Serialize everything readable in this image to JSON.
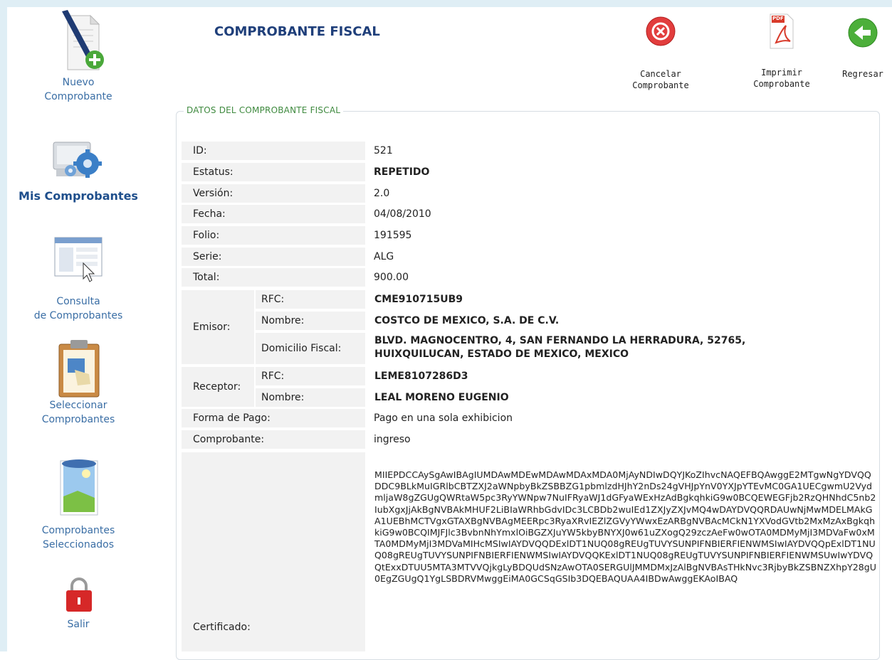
{
  "sidebar": {
    "items": [
      {
        "label_line1": "Nuevo",
        "label_line2": "Comprobante",
        "icon": "new-document-icon"
      },
      {
        "label_line1": "Mis Comprobantes",
        "label_line2": "",
        "icon": "gear-computer-icon",
        "active": true
      },
      {
        "label_line1": "Consulta",
        "label_line2": "de Comprobantes",
        "icon": "window-cursor-icon"
      },
      {
        "label_line1": "Seleccionar",
        "label_line2": "Comprobantes",
        "icon": "clipboard-icon"
      },
      {
        "label_line1": "Comprobantes",
        "label_line2": "Seleccionados",
        "icon": "picture-icon"
      },
      {
        "label_line1": "Salir",
        "label_line2": "",
        "icon": "lock-icon"
      }
    ]
  },
  "header": {
    "title": "COMPROBANTE FISCAL",
    "buttons": {
      "cancel_line1": "Cancelar",
      "cancel_line2": "Comprobante",
      "print_line1": "Imprimir",
      "print_line2": "Comprobante",
      "back": "Regresar",
      "pdf_badge": "PDF"
    }
  },
  "section": {
    "legend": "DATOS DEL COMPROBANTE FISCAL"
  },
  "fields": {
    "id_label": "ID:",
    "id_value": "521",
    "status_label": "Estatus:",
    "status_value": "REPETIDO",
    "version_label": "Versión:",
    "version_value": "2.0",
    "date_label": "Fecha:",
    "date_value": "04/08/2010",
    "folio_label": "Folio:",
    "folio_value": "191595",
    "serie_label": "Serie:",
    "serie_value": "ALG",
    "total_label": "Total:",
    "total_value": "900.00",
    "emisor_label": "Emisor:",
    "emisor_rfc_label": "RFC:",
    "emisor_rfc_value": "CME910715UB9",
    "emisor_name_label": "Nombre:",
    "emisor_name_value": "COSTCO DE MEXICO, S.A. DE C.V.",
    "emisor_addr_label": "Domicilio Fiscal:",
    "emisor_addr_line1": "BLVD. MAGNOCENTRO, 4, SAN FERNANDO LA HERRADURA, 52765,",
    "emisor_addr_line2": "HUIXQUILUCAN, ESTADO DE MEXICO, MEXICO",
    "receptor_label": "Receptor:",
    "receptor_rfc_label": "RFC:",
    "receptor_rfc_value": "LEME8107286D3",
    "receptor_name_label": "Nombre:",
    "receptor_name_value": "LEAL MORENO EUGENIO",
    "payment_label": "Forma de Pago:",
    "payment_value": "Pago en una sola exhibicion",
    "type_label": "Comprobante:",
    "type_value": "ingreso",
    "cert_label": "Certificado:",
    "cert_value": "MIIEPDCCAySgAwIBAgIUMDAwMDEwMDAwMDAxMDA0MjAyNDIwDQYJKoZIhvcNAQEFBQAwggE2MTgwNgYDVQQDDC9BLkMuIGRlbCBTZXJ2aWNpbyBkZSBBZG1pbmlzdHJhY2nDs24gVHJpYnV0YXJpYTEvMC0GA1UECgwmU2VydmljaW8gZGUgQWRtaW5pc3RyYWNpw7NuIFRyaWJ1dGFyaWExHzAdBgkqhkiG9w0BCQEWEGFjb2RzQHNhdC5nb2IubXgxJjAkBgNVBAkMHUF2LiBIaWRhbGdvIDc3LCBDb2wuIEd1ZXJyZXJvMQ4wDAYDVQQRDAUwNjMwMDELMAkGA1UEBhMCTVgxGTAXBgNVBAgMEERpc3RyaXRvIEZlZGVyYWwxEzARBgNVBAcMCkN1YXVodGVtb2MxMzAxBgkqhkiG9w0BCQIMJFJlc3BvbnNhYmxlOiBGZXJuYW5kbyBNYXJ0w61uZXogQ29zczAeFw0wOTA0MDMyMjI3MDVaFw0xMTA0MDMyMjI3MDVaMIHcMSIwIAYDVQQDExlDT1NUQ08gREUgTUVYSUNPIFNBIERFIENWMSIwIAYDVQQpExlDT1NUQ08gREUgTUVYSUNPIFNBIERFIENWMSIwIAYDVQQKExlDT1NUQ08gREUgTUVYSUNPIFNBIERFIENWMSUwIwYDVQQtExxDTUU5MTA3MTVVQjkgLyBDQUdSNzAwOTA0SERGUlJMMDMxJzAlBgNVBAsTHkNvc3RjbyBkZSBNZXhpY28gU0EgZGUgQ1YgLSBDRVMwggEiMA0GCSqGSIb3DQEBAQUAA4IBDwAwggEKAoIBAQ"
  }
}
